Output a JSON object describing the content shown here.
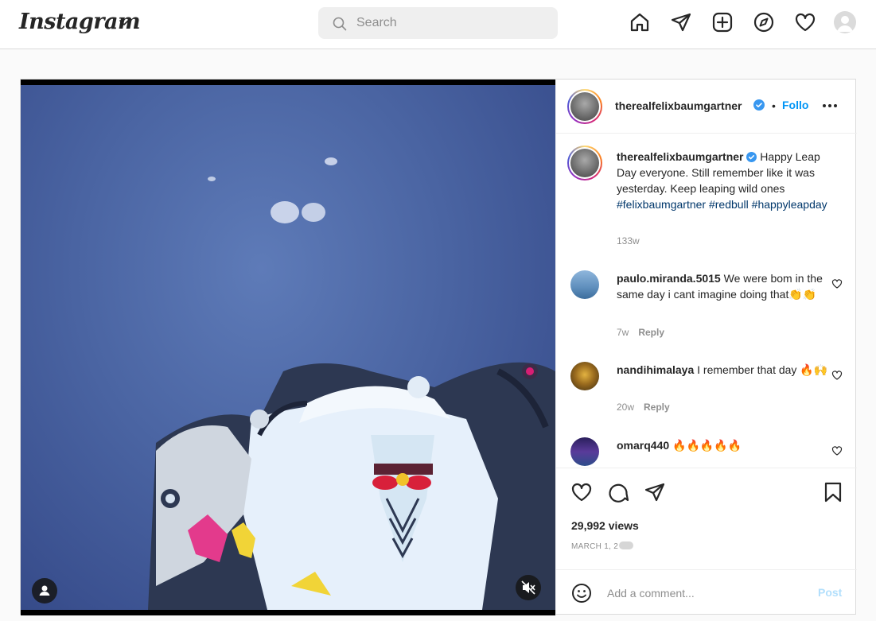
{
  "app": {
    "logo": "Instagram"
  },
  "search": {
    "placeholder": "Search"
  },
  "post": {
    "username": "therealfelixbaumgartner",
    "follow_label": "Follo",
    "caption_text": "Happy Leap Day everyone. Still remember like it was yesterday. Keep leaping wild ones ",
    "hashtags": [
      "#felixbaumgartner",
      "#redbull",
      "#happyleapday"
    ],
    "caption_time": "133w",
    "views": "29,992 views",
    "date": "MARCH 1, 2"
  },
  "comments": [
    {
      "username": "paulo.miranda.5015",
      "text": "We were bom in the same day i cant imagine doing that👏👏",
      "time": "7w",
      "reply": "Reply"
    },
    {
      "username": "nandihimalaya",
      "text": "I remember that day 🔥🙌",
      "time": "20w",
      "reply": "Reply"
    },
    {
      "username": "omarq440",
      "text": "🔥🔥🔥🔥🔥",
      "time": "",
      "reply": ""
    }
  ],
  "add_comment": {
    "placeholder": "Add a comment...",
    "post_label": "Post"
  },
  "colors": {
    "accent": "#0095f6",
    "hashtag": "#00376b",
    "post_disabled": "#b2dffc"
  }
}
